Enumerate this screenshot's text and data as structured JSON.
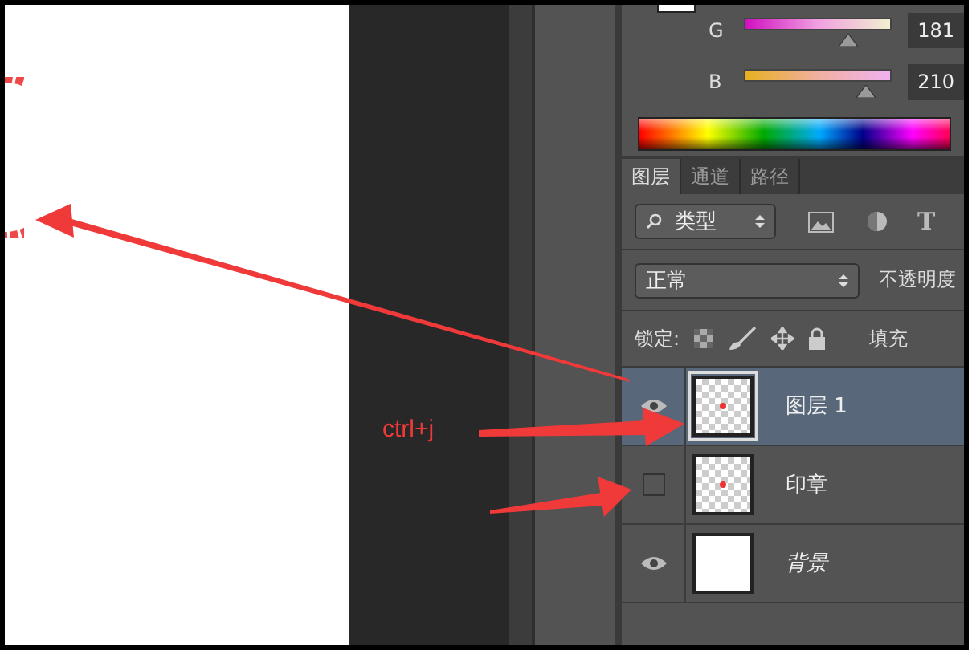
{
  "color_sliders": [
    {
      "label": "G",
      "value": "181",
      "level": 0.71
    },
    {
      "label": "B",
      "value": "210",
      "level": 0.83
    }
  ],
  "tabs": [
    {
      "label": "图层",
      "selected": true
    },
    {
      "label": "通道",
      "selected": false
    },
    {
      "label": "路径",
      "selected": false
    }
  ],
  "filter": {
    "value": "类型",
    "type_glyph": "T"
  },
  "blend_mode": {
    "value": "正常",
    "opacity_label": "不透明度"
  },
  "lock": {
    "label": "锁定:",
    "fill_label": "填充"
  },
  "layers": [
    {
      "name": "图层 1",
      "kind": "layer",
      "selected": true,
      "visible": true
    },
    {
      "name": "印章",
      "kind": "layer",
      "selected": false,
      "visible": false
    },
    {
      "name": "背景",
      "kind": "background",
      "selected": false,
      "visible": true
    }
  ],
  "annotation": {
    "label": "ctrl+j"
  }
}
